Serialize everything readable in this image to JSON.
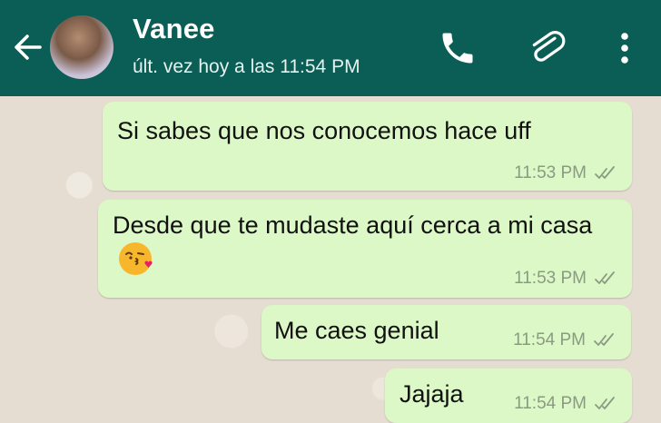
{
  "header": {
    "contact_name": "Vanee",
    "last_seen": "últ. vez hoy a las 11:54 PM",
    "icons": {
      "back": "arrow-left-icon",
      "call": "phone-icon",
      "attach": "paperclip-icon",
      "menu": "more-vert-icon"
    }
  },
  "messages": [
    {
      "text": "Si sabes que nos conocemos hace uff",
      "time": "11:53 PM",
      "status": "delivered-double-check"
    },
    {
      "text": "Desde que te mudaste aquí  cerca a mi casa",
      "emoji": "kissing-face-emoji",
      "time": "11:53 PM",
      "status": "delivered-double-check"
    },
    {
      "text": "Me caes genial",
      "time": "11:54 PM",
      "status": "delivered-double-check"
    },
    {
      "text": "Jajaja",
      "time": "11:54 PM",
      "status": "delivered-double-check"
    }
  ],
  "colors": {
    "header_bg": "#0b5e55",
    "outgoing_bubble": "#dcf8c6",
    "chat_bg": "#e5ddd1",
    "meta_text": "#8a9a83"
  }
}
